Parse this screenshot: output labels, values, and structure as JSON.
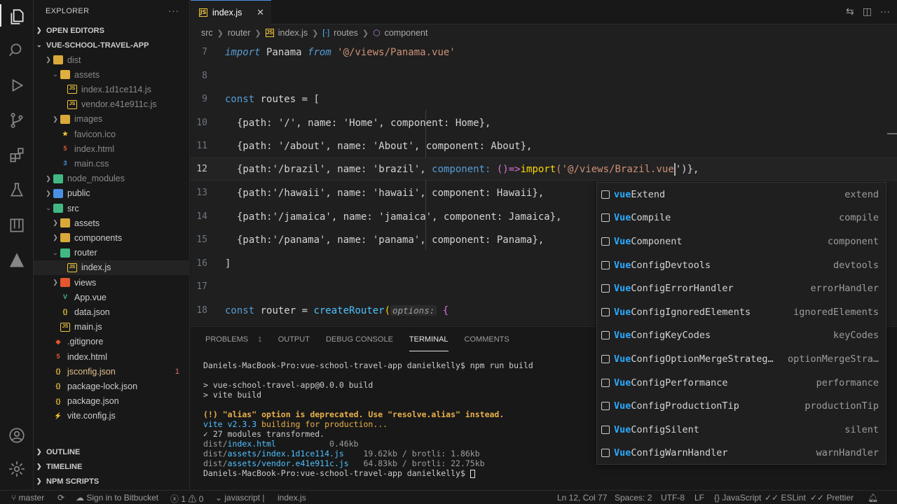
{
  "sidebar": {
    "title": "EXPLORER",
    "more": "···",
    "sections": {
      "open_editors": "OPEN EDITORS",
      "project": "VUE-SCHOOL-TRAVEL-APP",
      "outline": "OUTLINE",
      "timeline": "TIMELINE",
      "npm_scripts": "NPM SCRIPTS"
    },
    "tree": [
      {
        "label": "dist",
        "icon": "folder-icon"
      },
      {
        "label": "assets",
        "icon": "folder-open-icon"
      },
      {
        "label": "index.1d1ce114.js",
        "icon": "js-file-icon"
      },
      {
        "label": "vendor.e41e911c.js",
        "icon": "js-file-icon"
      },
      {
        "label": "images",
        "icon": "folder-icon"
      },
      {
        "label": "favicon.ico",
        "icon": "favicon-icon"
      },
      {
        "label": "index.html",
        "icon": "html-file-icon"
      },
      {
        "label": "main.css",
        "icon": "css-file-icon"
      },
      {
        "label": "node_modules",
        "icon": "folder-icon"
      },
      {
        "label": "public",
        "icon": "folder-icon"
      },
      {
        "label": "src",
        "icon": "folder-open-icon"
      },
      {
        "label": "assets",
        "icon": "folder-icon"
      },
      {
        "label": "components",
        "icon": "folder-icon"
      },
      {
        "label": "router",
        "icon": "folder-open-icon"
      },
      {
        "label": "index.js",
        "icon": "js-file-icon"
      },
      {
        "label": "views",
        "icon": "folder-icon"
      },
      {
        "label": "App.vue",
        "icon": "vue-file-icon"
      },
      {
        "label": "data.json",
        "icon": "json-file-icon"
      },
      {
        "label": "main.js",
        "icon": "js-file-icon"
      },
      {
        "label": ".gitignore",
        "icon": "git-file-icon"
      },
      {
        "label": "index.html",
        "icon": "html-file-icon"
      },
      {
        "label": "jsconfig.json",
        "icon": "json-file-icon",
        "badge": "1"
      },
      {
        "label": "package-lock.json",
        "icon": "json-file-icon"
      },
      {
        "label": "package.json",
        "icon": "json-file-icon"
      },
      {
        "label": "vite.config.js",
        "icon": "vite-file-icon"
      }
    ]
  },
  "editor": {
    "tab": "index.js",
    "breadcrumb": [
      "src",
      "router",
      "index.js",
      "routes",
      "component"
    ],
    "line_numbers": [
      "7",
      "8",
      "9",
      "10",
      "11",
      "12",
      "13",
      "14",
      "15",
      "16",
      "17",
      "18"
    ],
    "code": {
      "l7_kw": "import",
      "l7_name": " Panama ",
      "l7_from": "from",
      "l7_str": " '@/views/Panama.vue'",
      "l9_const": "const",
      "l9_rest": " routes = [",
      "l10": "{path: '/', name: 'Home', component: Home},",
      "l11": "{path: '/about', name: 'About', component: About},",
      "l12_a": "{path:'/brazil', name: 'brazil', ",
      "l12_b": "component: ",
      "l12_c": "()=>",
      "l12_d": "import",
      "l12_e": "('@/views/Brazil.vue",
      "l12_f": "')},",
      "l13": "{path:'/hawaii', name: 'hawaii', component: Hawaii},",
      "l14": "{path:'/jamaica', name: 'jamaica', component: Jamaica},",
      "l15": "{path:'/panama', name: 'panama', component: Panama},",
      "l16": "]",
      "l18_const": "const",
      "l18_rest": " router = ",
      "l18_fn": "createRouter",
      "l18_paren": "(",
      "l18_hint": "options:",
      "l18_end": " {"
    }
  },
  "suggest": [
    {
      "match": "vue",
      "rest": "Extend",
      "detail": "extend"
    },
    {
      "match": "Vue",
      "rest": "Compile",
      "detail": "compile"
    },
    {
      "match": "Vue",
      "rest": "Component",
      "detail": "component"
    },
    {
      "match": "Vue",
      "rest": "ConfigDevtools",
      "detail": "devtools"
    },
    {
      "match": "Vue",
      "rest": "ConfigErrorHandler",
      "detail": "errorHandler"
    },
    {
      "match": "Vue",
      "rest": "ConfigIgnoredElements",
      "detail": "ignoredElements"
    },
    {
      "match": "Vue",
      "rest": "ConfigKeyCodes",
      "detail": "keyCodes"
    },
    {
      "match": "Vue",
      "rest": "ConfigOptionMergeStrateg…",
      "detail": "optionMergeStra…"
    },
    {
      "match": "Vue",
      "rest": "ConfigPerformance",
      "detail": "performance"
    },
    {
      "match": "Vue",
      "rest": "ConfigProductionTip",
      "detail": "productionTip"
    },
    {
      "match": "Vue",
      "rest": "ConfigSilent",
      "detail": "silent"
    },
    {
      "match": "Vue",
      "rest": "ConfigWarnHandler",
      "detail": "warnHandler"
    }
  ],
  "panel": {
    "tabs": {
      "problems": "PROBLEMS",
      "problems_badge": "1",
      "output": "OUTPUT",
      "debug": "DEBUG CONSOLE",
      "terminal": "TERMINAL",
      "comments": "COMMENTS"
    },
    "terminal": {
      "prompt1": "Daniels-MacBook-Pro:vue-school-travel-app danielkelly$ npm run build",
      "l2": "> vue-school-travel-app@0.0.0 build",
      "l3": "> vite build",
      "warn": "(!) \"alias\" option is deprecated. Use \"resolve.alias\" instead.",
      "vite_a": "vite v2.3.3",
      "vite_b": " building for production...",
      "mods": "✓ 27 modules transformed.",
      "f1_dir": "dist/",
      "f1_name": "index.html",
      "f1_size": "           0.46kb",
      "f2_dir": "dist/",
      "f2_name": "assets/index.1d1ce114.js",
      "f2_size": "    19.62kb / brotli: 1.86kb",
      "f3_dir": "dist/",
      "f3_name": "assets/vendor.e41e911c.js",
      "f3_size": "   64.83kb / brotli: 22.75kb",
      "prompt2": "Daniels-MacBook-Pro:vue-school-travel-app danielkelly$ "
    }
  },
  "status": {
    "branch": "master",
    "bitbucket": "Sign in to Bitbucket",
    "errors": "1",
    "warnings": "0",
    "lang_crumb": "javascript |",
    "file_crumb": "index.js",
    "position": "Ln 12, Col 77",
    "spaces": "Spaces: 2",
    "encoding": "UTF-8",
    "eol": "LF",
    "language": "JavaScript",
    "eslint": "ESLint",
    "prettier": "Prettier"
  }
}
